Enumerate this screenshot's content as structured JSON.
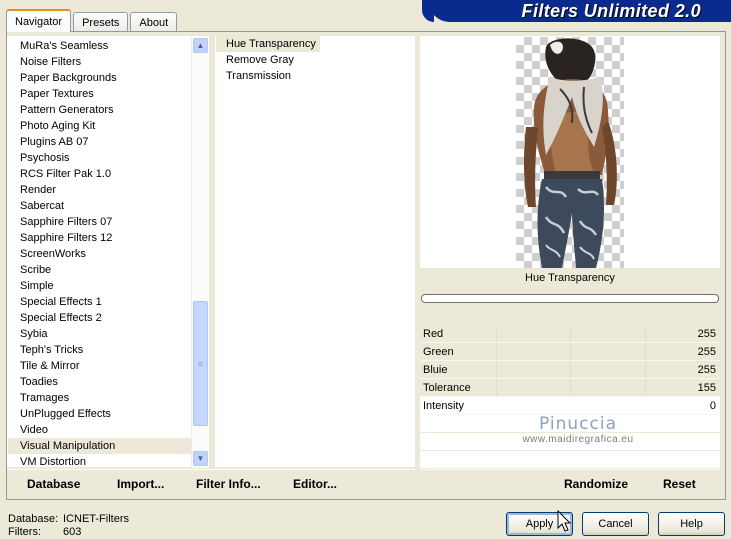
{
  "tabs": [
    {
      "label": "Navigator",
      "active": true
    },
    {
      "label": "Presets",
      "active": false
    },
    {
      "label": "About",
      "active": false
    }
  ],
  "banner": {
    "title": "Filters Unlimited 2.0"
  },
  "categories": [
    "MuRa's Seamless",
    "Noise Filters",
    "Paper Backgrounds",
    "Paper Textures",
    "Pattern Generators",
    "Photo Aging Kit",
    "Plugins AB 07",
    "Psychosis",
    "RCS Filter Pak 1.0",
    "Render",
    "Sabercat",
    "Sapphire Filters 07",
    "Sapphire Filters 12",
    "ScreenWorks",
    "Scribe",
    "Simple",
    "Special Effects 1",
    "Special Effects 2",
    "Sybia",
    "Teph's Tricks",
    "Tile & Mirror",
    "Toadies",
    "Tramages",
    "UnPlugged Effects",
    "Video",
    "Visual Manipulation",
    "VM Distortion"
  ],
  "selected_category": "Visual Manipulation",
  "filters": [
    "Hue Transparency",
    "Remove Gray",
    "Transmission"
  ],
  "selected_filter": "Hue Transparency",
  "preview": {
    "filter_name": "Hue Transparency",
    "progress": 0
  },
  "params": [
    {
      "name": "Red",
      "value": "255"
    },
    {
      "name": "Green",
      "value": "255"
    },
    {
      "name": "Bluie",
      "value": "255"
    },
    {
      "name": "Tolerance",
      "value": "155"
    },
    {
      "name": "Intensity",
      "value": "0"
    }
  ],
  "watermark": {
    "name": "Pinuccia",
    "url": "www.maidiregrafica.eu"
  },
  "left_toolbar": {
    "database": "Database",
    "import": "Import...",
    "filter_info": "Filter Info...",
    "editor": "Editor..."
  },
  "right_toolbar": {
    "randomize": "Randomize",
    "reset": "Reset"
  },
  "status": {
    "database_label": "Database:",
    "database_value": "ICNET-Filters",
    "filters_label": "Filters:",
    "filters_value": "603"
  },
  "buttons": {
    "apply": "Apply",
    "cancel": "Cancel",
    "help": "Help"
  },
  "colors": {
    "banner": "#0a2a8e",
    "dialog_bg": "#ece9d8",
    "scrollbar": "#c1d3fb"
  }
}
